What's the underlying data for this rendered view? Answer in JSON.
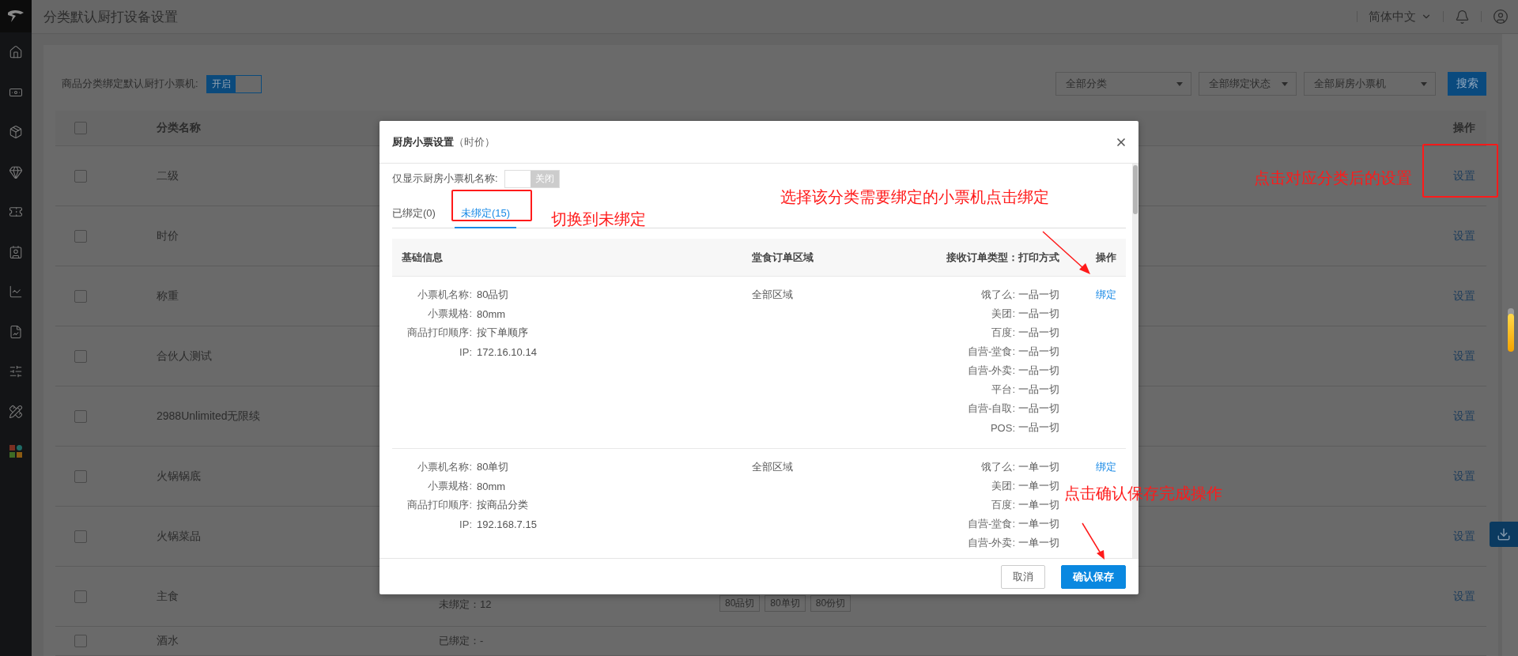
{
  "header": {
    "title": "分类默认厨打设备设置",
    "language": "简体中文"
  },
  "toolbar": {
    "toggle": {
      "label": "商品分类绑定默认厨打小票机:",
      "text": "开启",
      "on": true
    },
    "filters": [
      {
        "value": "全部分类"
      },
      {
        "value": "全部绑定状态"
      },
      {
        "value": "全部厨房小票机"
      }
    ],
    "search_button": "搜索"
  },
  "table": {
    "select_all_checked": false,
    "columns": [
      "分类名称",
      "操作"
    ],
    "rows": [
      {
        "name": "二级",
        "checked": false,
        "action": "设置"
      },
      {
        "name": "时价",
        "checked": false,
        "action": "设置"
      },
      {
        "name": "称重",
        "checked": false,
        "action": "设置"
      },
      {
        "name": "合伙人测试",
        "checked": false,
        "action": "设置"
      },
      {
        "name": "2988Unlimited无限续",
        "checked": false,
        "action": "设置"
      },
      {
        "name": "火锅锅底",
        "checked": false,
        "action": "设置"
      },
      {
        "name": "火锅菜品",
        "checked": false,
        "action": "设置"
      },
      {
        "name": "主食",
        "checked": false,
        "action": "设置",
        "binding": "未绑定：12",
        "printer_tags": [
          "80品切",
          "80单切",
          "80份切"
        ]
      },
      {
        "name": "酒水",
        "checked": false,
        "binding": "已绑定：-"
      }
    ]
  },
  "dialog": {
    "title": "厨房小票设置",
    "subtitle": "（时价）",
    "filter_toggle": {
      "label": "仅显示厨房小票机名称:",
      "text": "关闭",
      "on": false
    },
    "tabs": [
      {
        "label": "已绑定(0)",
        "selected": false
      },
      {
        "label": "未绑定(15)",
        "selected": true
      }
    ],
    "columns": [
      "基础信息",
      "堂食订单区域",
      "接收订单类型：打印方式",
      "操作"
    ],
    "printers": [
      {
        "info": [
          {
            "label": "小票机名称:",
            "value": "80品切"
          },
          {
            "label": "小票规格:",
            "value": "80mm"
          },
          {
            "label": "商品打印顺序:",
            "value": "按下单顺序"
          },
          {
            "label": "IP:",
            "value": "172.16.10.14"
          }
        ],
        "area": "全部区域",
        "order_types": [
          {
            "label": "饿了么:",
            "value": "一品一切"
          },
          {
            "label": "美团:",
            "value": "一品一切"
          },
          {
            "label": "百度:",
            "value": "一品一切"
          },
          {
            "label": "自营-堂食:",
            "value": "一品一切"
          },
          {
            "label": "自营-外卖:",
            "value": "一品一切"
          },
          {
            "label": "平台:",
            "value": "一品一切"
          },
          {
            "label": "自营-自取:",
            "value": "一品一切"
          },
          {
            "label": "POS:",
            "value": "一品一切"
          }
        ],
        "action": "绑定"
      },
      {
        "info": [
          {
            "label": "小票机名称:",
            "value": "80单切"
          },
          {
            "label": "小票规格:",
            "value": "80mm"
          },
          {
            "label": "商品打印顺序:",
            "value": "按商品分类"
          },
          {
            "label": "IP:",
            "value": "192.168.7.15"
          }
        ],
        "area": "全部区域",
        "order_types": [
          {
            "label": "饿了么:",
            "value": "一单一切"
          },
          {
            "label": "美团:",
            "value": "一单一切"
          },
          {
            "label": "百度:",
            "value": "一单一切"
          },
          {
            "label": "自营-堂食:",
            "value": "一单一切"
          },
          {
            "label": "自营-外卖:",
            "value": "一单一切"
          }
        ],
        "action": "绑定"
      }
    ],
    "buttons": [
      {
        "label": "取消",
        "kind": "secondary"
      },
      {
        "label": "确认保存",
        "kind": "primary"
      }
    ]
  },
  "annotations": [
    {
      "text": "切换到未绑定"
    },
    {
      "text": "选择该分类需要绑定的小票机点击绑定"
    },
    {
      "text": "点击对应分类后的设置"
    },
    {
      "text": "点击确认保存完成操作"
    }
  ]
}
